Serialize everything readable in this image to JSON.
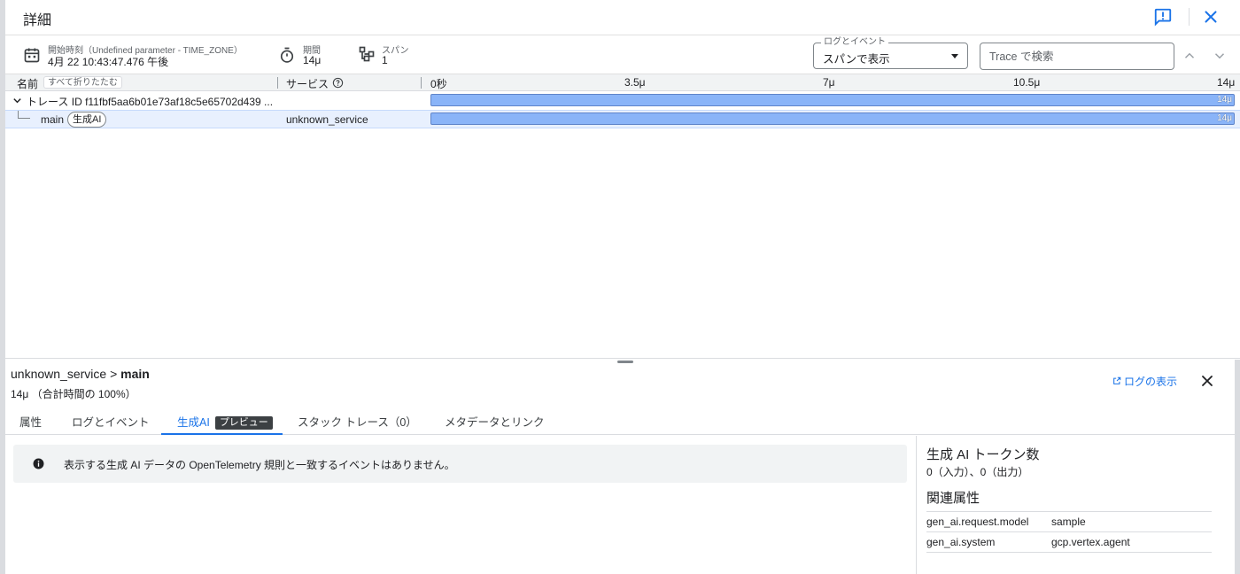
{
  "header": {
    "title": "詳細"
  },
  "info": {
    "start_label": "開始時刻（Undefined parameter - TIME_ZONE）",
    "start_value": "4月 22 10:43:47.476 午後",
    "duration_label": "期間",
    "duration_value": "14μ",
    "spans_label": "スパン",
    "spans_value": "1",
    "log_select_legend": "ログとイベント",
    "log_select_value": "スパンで表示",
    "search_placeholder": "Trace で検索"
  },
  "columns": {
    "name": "名前",
    "collapse_all": "すべて折りたたむ",
    "service": "サービス",
    "ticks": [
      "0秒",
      "3.5μ",
      "7μ",
      "10.5μ",
      "14μ"
    ]
  },
  "rows": [
    {
      "name": "トレース ID f11fbf5aa6b01e73af18c5e65702d439 ...",
      "service": "",
      "bar_label": "14μ",
      "fraction": 1.0
    },
    {
      "name": "main",
      "chip": "生成AI",
      "service": "unknown_service",
      "bar_label": "14μ",
      "fraction": 1.0
    }
  ],
  "detail": {
    "breadcrumb_service": "unknown_service",
    "breadcrumb_sep": ">",
    "breadcrumb_span": "main",
    "duration": "14μ （合計時間の 100%）",
    "view_logs": "ログの表示",
    "tabs": [
      "属性",
      "ログとイベント",
      "生成AI",
      "スタック トレース（0）",
      "メタデータとリンク"
    ],
    "active_tab": "生成AI",
    "preview_badge": "プレビュー",
    "notice": "表示する生成 AI データの OpenTelemetry 規則と一致するイベントはありません。",
    "tokens_title": "生成 AI トークン数",
    "tokens_value": "0（入力）、0（出力）",
    "related_title": "関連属性",
    "attributes": [
      {
        "key": "gen_ai.request.model",
        "value": "sample"
      },
      {
        "key": "gen_ai.system",
        "value": "gcp.vertex.agent"
      }
    ]
  },
  "colors": {
    "accent": "#1a73e8",
    "bar": "#8ab4f8",
    "selected_row": "#e8f0fe"
  }
}
